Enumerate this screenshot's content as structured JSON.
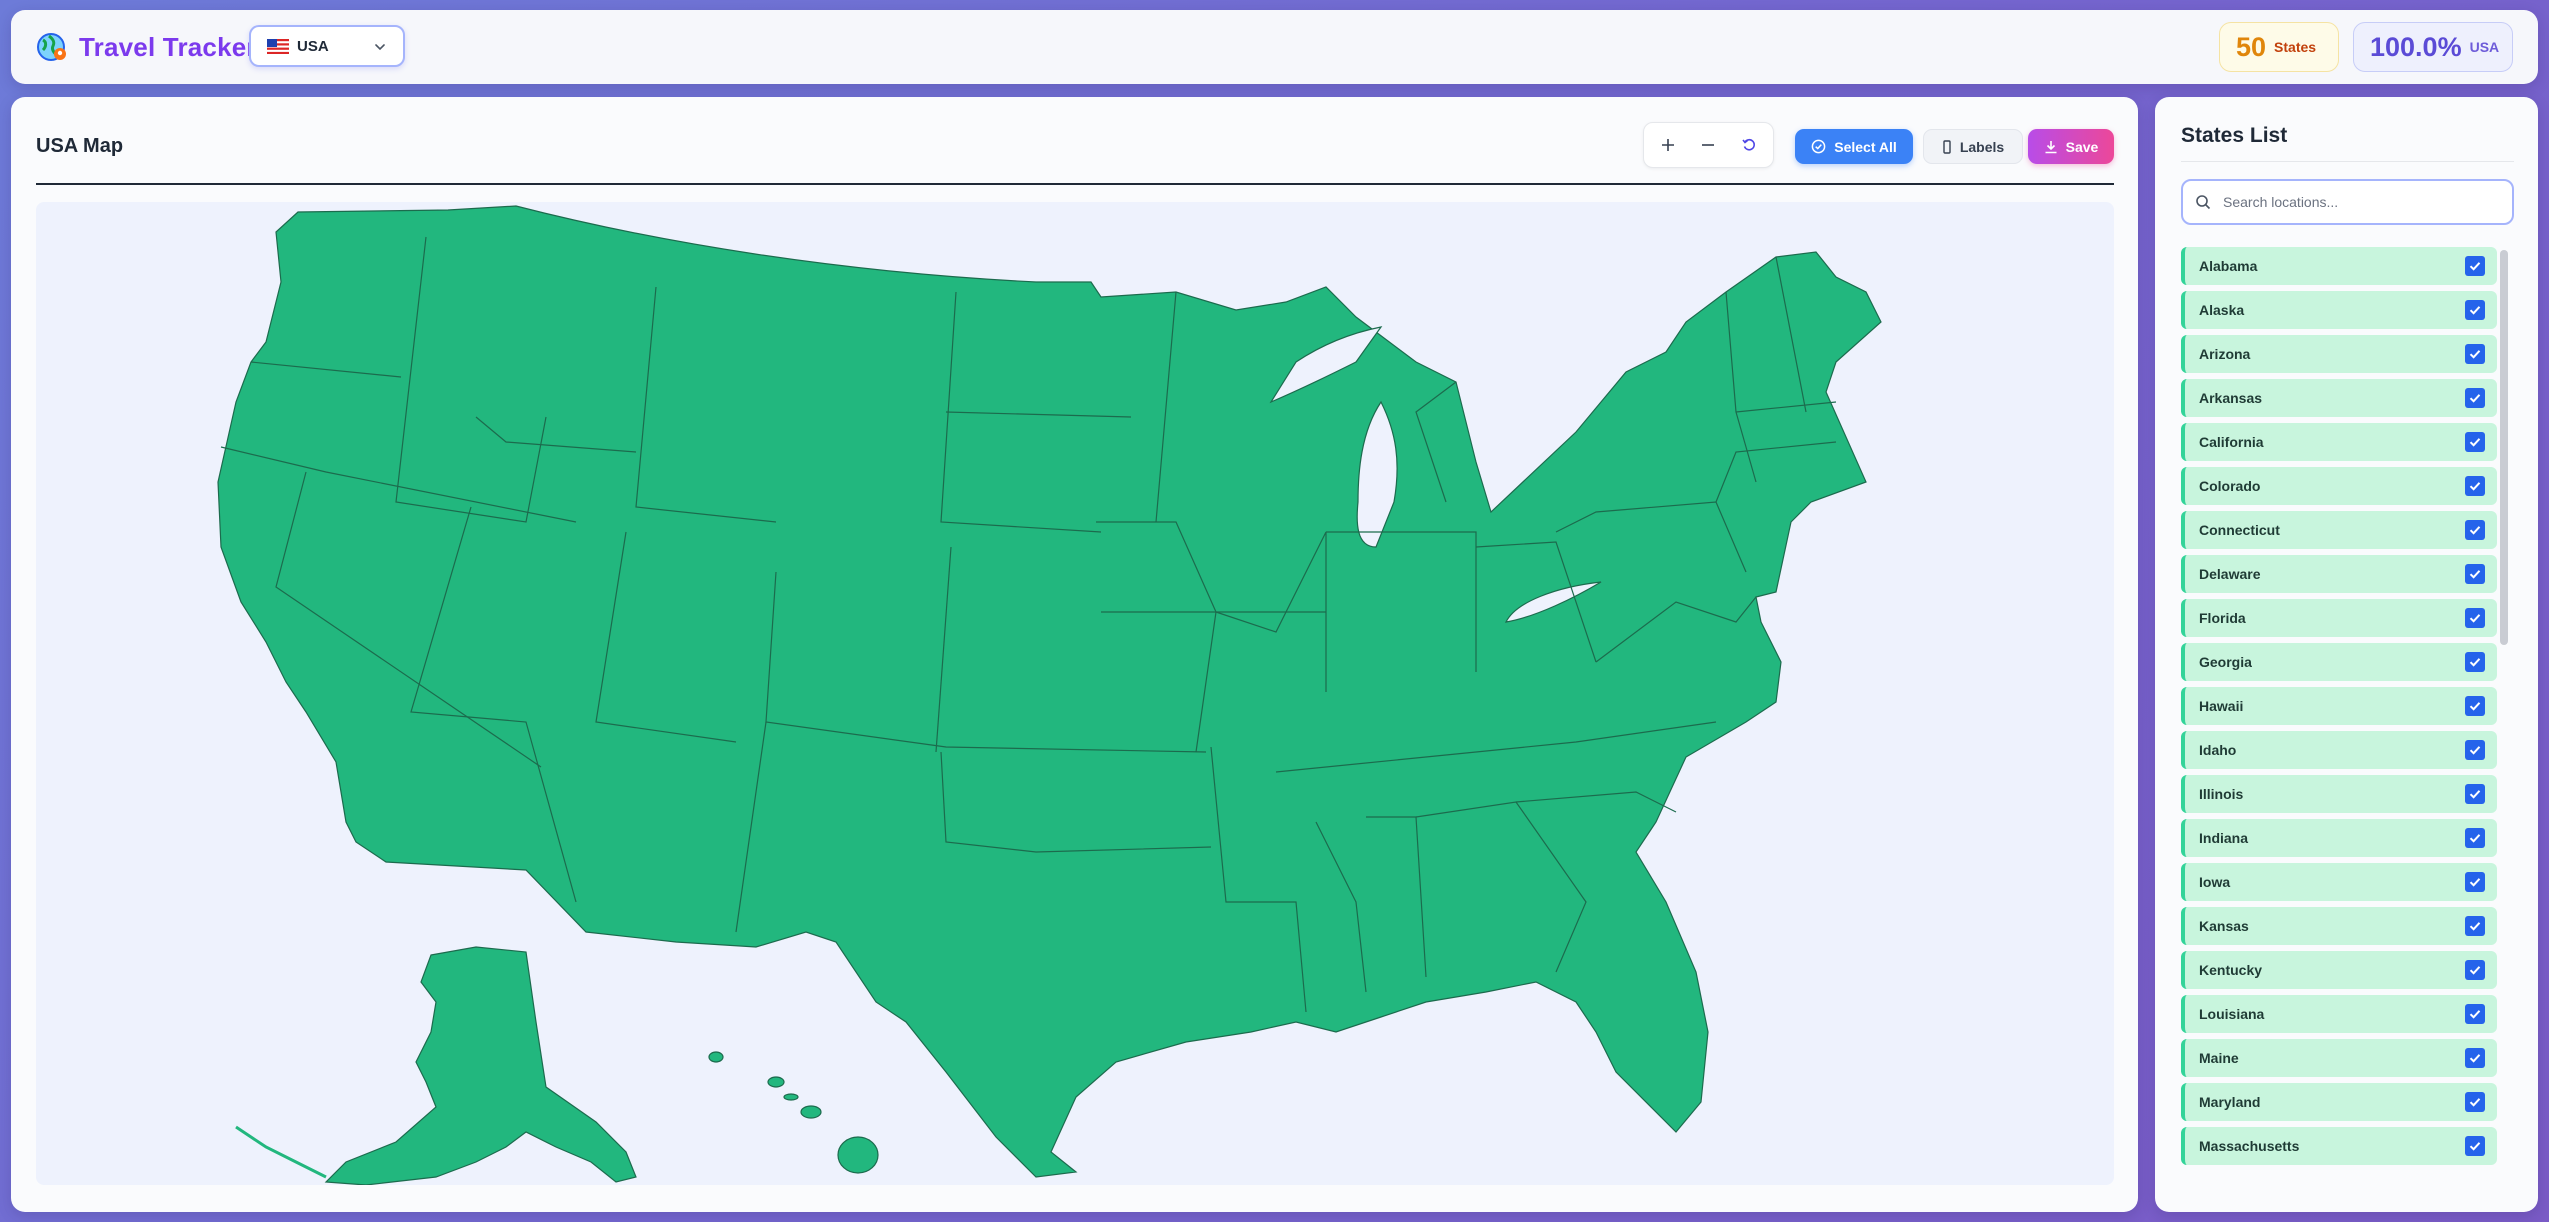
{
  "app": {
    "title": "Travel Tracker",
    "country_selected": "USA"
  },
  "stats": {
    "states_count": "50",
    "states_label": "States",
    "percent": "100.0%",
    "percent_label": "USA"
  },
  "map_panel": {
    "title": "USA Map",
    "select_all_label": "Select All",
    "labels_label": "Labels",
    "save_label": "Save"
  },
  "colors": {
    "visited_fill": "#22b77e",
    "state_border": "#1c6b4d",
    "accent": "#7c3aed"
  },
  "sidebar": {
    "title": "States List",
    "search_placeholder": "Search locations...",
    "items": [
      {
        "label": "Alabama",
        "checked": true
      },
      {
        "label": "Alaska",
        "checked": true
      },
      {
        "label": "Arizona",
        "checked": true
      },
      {
        "label": "Arkansas",
        "checked": true
      },
      {
        "label": "California",
        "checked": true
      },
      {
        "label": "Colorado",
        "checked": true
      },
      {
        "label": "Connecticut",
        "checked": true
      },
      {
        "label": "Delaware",
        "checked": true
      },
      {
        "label": "Florida",
        "checked": true
      },
      {
        "label": "Georgia",
        "checked": true
      },
      {
        "label": "Hawaii",
        "checked": true
      },
      {
        "label": "Idaho",
        "checked": true
      },
      {
        "label": "Illinois",
        "checked": true
      },
      {
        "label": "Indiana",
        "checked": true
      },
      {
        "label": "Iowa",
        "checked": true
      },
      {
        "label": "Kansas",
        "checked": true
      },
      {
        "label": "Kentucky",
        "checked": true
      },
      {
        "label": "Louisiana",
        "checked": true
      },
      {
        "label": "Maine",
        "checked": true
      },
      {
        "label": "Maryland",
        "checked": true
      },
      {
        "label": "Massachusetts",
        "checked": true
      }
    ]
  }
}
